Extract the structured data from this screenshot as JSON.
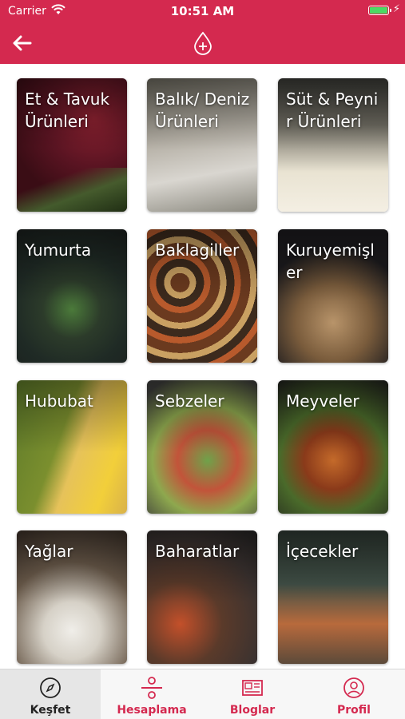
{
  "status": {
    "carrier": "Carrier",
    "time": "10:51 AM"
  },
  "categories": [
    {
      "label": "Et & Tavuk Ürünleri"
    },
    {
      "label": "Balık/ Deniz Ürünleri"
    },
    {
      "label": "Süt & Peynir Ürünleri"
    },
    {
      "label": "Yumurta"
    },
    {
      "label": "Baklagiller"
    },
    {
      "label": "Kuruyemişler"
    },
    {
      "label": "Hububat"
    },
    {
      "label": "Sebzeler"
    },
    {
      "label": "Meyveler"
    },
    {
      "label": "Yağlar"
    },
    {
      "label": "Baharatlar"
    },
    {
      "label": "İçecekler"
    }
  ],
  "tabs": [
    {
      "label": "Keşfet",
      "icon": "compass-icon",
      "active": true
    },
    {
      "label": "Hesaplama",
      "icon": "divide-icon",
      "active": false
    },
    {
      "label": "Bloglar",
      "icon": "newspaper-icon",
      "active": false
    },
    {
      "label": "Profil",
      "icon": "user-icon",
      "active": false
    }
  ],
  "colors": {
    "brand": "#d4294f",
    "tab_active": "#222222",
    "tab_inactive": "#d4294f"
  }
}
